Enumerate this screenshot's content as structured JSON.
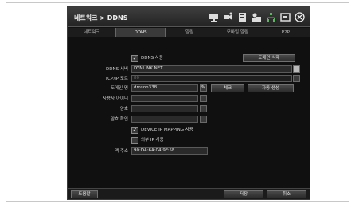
{
  "window": {
    "title": "네트워크 > DDNS"
  },
  "toolbar_icons": [
    "monitor-icon",
    "camera-settings-icon",
    "storage-icon",
    "event-icon",
    "network-icon",
    "system-icon",
    "close-icon"
  ],
  "tabs": [
    {
      "label": "네트워크",
      "active": false
    },
    {
      "label": "DDNS",
      "active": true
    },
    {
      "label": "알림",
      "active": false
    },
    {
      "label": "모바일 알림",
      "active": false
    },
    {
      "label": "P2P",
      "active": false
    }
  ],
  "form": {
    "ddns_use": {
      "label": "DDNS 사용",
      "checked": true
    },
    "delete_domain_button": "도메인 삭제",
    "ddns_server": {
      "label": "DDNS 서버",
      "value": "DYNLINK.NET"
    },
    "tcpip_port": {
      "label": "TCP/IP 포트",
      "value": "80"
    },
    "domain_name": {
      "label": "도메인 명",
      "value": "dmson338"
    },
    "check_button": "체크",
    "auto_create_button": "자동 생성",
    "user_id": {
      "label": "사용자 아이디",
      "value": ""
    },
    "password": {
      "label": "암호",
      "value": ""
    },
    "password_confirm": {
      "label": "암호 확인",
      "value": ""
    },
    "device_ip_mapping": {
      "label": "DEVICE IP MAPPING 사용",
      "checked": true
    },
    "external_ip": {
      "label": "외부 IP 사용",
      "checked": false
    },
    "mac_address": {
      "label": "맥 주소",
      "value": "90:DA:6A:04:9F:5F"
    }
  },
  "footer": {
    "help_button": "도움말",
    "save_button": "저장",
    "cancel_button": "취소"
  },
  "colors": {
    "background": "#101010",
    "panel": "#232323",
    "text": "#d8d8d8",
    "network_icon": "#5cb85c"
  }
}
